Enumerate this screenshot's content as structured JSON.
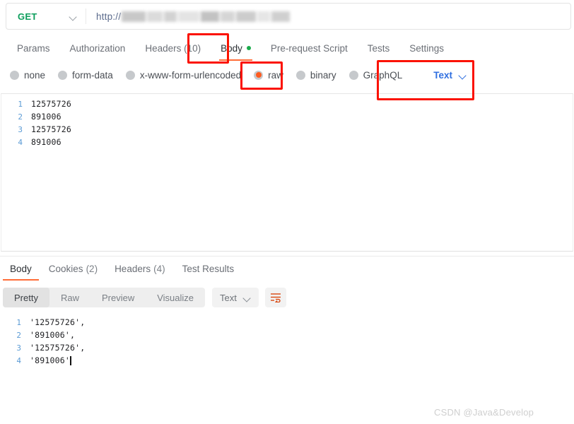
{
  "request_bar": {
    "method": "GET",
    "method_chevron_icon": "chevron-down-icon",
    "url_protocol": "http://",
    "url_redacted": true
  },
  "request_tabs": [
    {
      "label": "Params",
      "active": false
    },
    {
      "label": "Authorization",
      "active": false
    },
    {
      "label": "Headers (10)",
      "active": false
    },
    {
      "label": "Body",
      "active": true,
      "dot": "green"
    },
    {
      "label": "Pre-request Script",
      "active": false
    },
    {
      "label": "Tests",
      "active": false
    },
    {
      "label": "Settings",
      "active": false
    }
  ],
  "body_type_options": [
    {
      "label": "none",
      "checked": false
    },
    {
      "label": "form-data",
      "checked": false
    },
    {
      "label": "x-www-form-urlencoded",
      "checked": false
    },
    {
      "label": "raw",
      "checked": true
    },
    {
      "label": "binary",
      "checked": false
    },
    {
      "label": "GraphQL",
      "checked": false
    }
  ],
  "body_format_select": {
    "value": "Text",
    "chevron_icon": "chevron-down-icon"
  },
  "request_editor": {
    "lines": [
      {
        "n": "1",
        "text": "12575726"
      },
      {
        "n": "2",
        "text": "891006"
      },
      {
        "n": "3",
        "text": "12575726"
      },
      {
        "n": "4",
        "text": "891006"
      }
    ]
  },
  "response_tabs": [
    {
      "label": "Body",
      "count": "",
      "active": true
    },
    {
      "label": "Cookies",
      "count": "(2)",
      "active": false
    },
    {
      "label": "Headers",
      "count": "(4)",
      "active": false
    },
    {
      "label": "Test Results",
      "count": "",
      "active": false
    }
  ],
  "response_toolbar": {
    "segments": [
      {
        "label": "Pretty",
        "active": true
      },
      {
        "label": "Raw",
        "active": false
      },
      {
        "label": "Preview",
        "active": false
      },
      {
        "label": "Visualize",
        "active": false
      }
    ],
    "format_select": {
      "value": "Text",
      "chevron_icon": "chevron-down-icon"
    },
    "wrap_button_icon": "word-wrap-icon"
  },
  "response_body": {
    "lines": [
      {
        "n": "1",
        "text": "'12575726',"
      },
      {
        "n": "2",
        "text": "'891006',"
      },
      {
        "n": "3",
        "text": "'12575726',"
      },
      {
        "n": "4",
        "text": "'891006'"
      }
    ]
  },
  "annotations": {
    "colors": {
      "box": "#fb1200",
      "accent": "#ff6c37",
      "link": "#2f6fe0",
      "method": "#0d9e5c"
    }
  },
  "watermark": {
    "text": "CSDN @Java&Develop"
  }
}
